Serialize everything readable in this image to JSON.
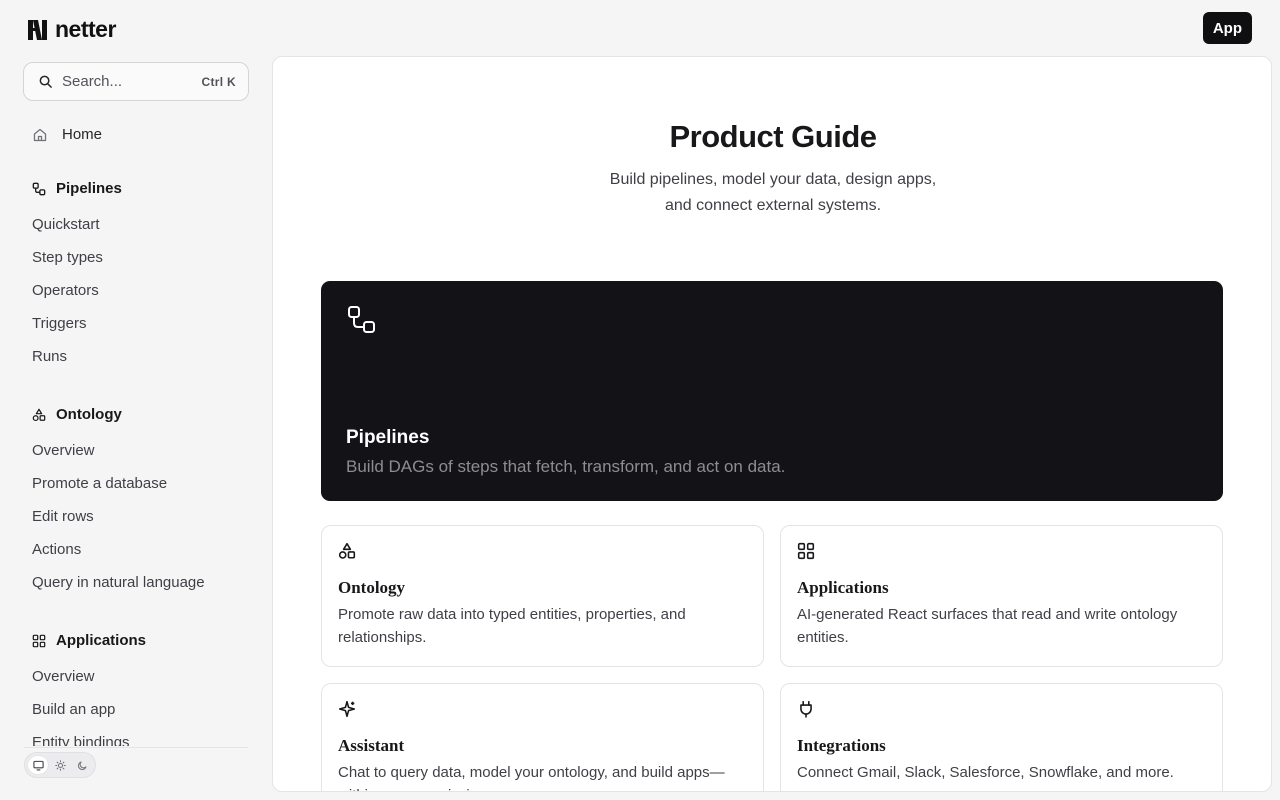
{
  "brand": {
    "name": "netter"
  },
  "header": {
    "app_button": "App"
  },
  "search": {
    "placeholder": "Search...",
    "shortcut": "Ctrl K"
  },
  "sidebar": {
    "home": "Home",
    "sections": [
      {
        "title": "Pipelines",
        "icon": "pipeline-icon",
        "items": [
          "Quickstart",
          "Step types",
          "Operators",
          "Triggers",
          "Runs"
        ]
      },
      {
        "title": "Ontology",
        "icon": "shapes-icon",
        "items": [
          "Overview",
          "Promote a database",
          "Edit rows",
          "Actions",
          "Query in natural language"
        ]
      },
      {
        "title": "Applications",
        "icon": "layout-grid-icon",
        "items": [
          "Overview",
          "Build an app",
          "Entity bindings"
        ]
      }
    ]
  },
  "theme": {
    "options": [
      "monitor-icon",
      "sun-icon",
      "moon-icon"
    ],
    "active": "system"
  },
  "main": {
    "title": "Product Guide",
    "subtitle": "Build pipelines, model your data, design apps, and connect external systems.",
    "hero": {
      "title": "Pipelines",
      "description": "Build DAGs of steps that fetch, transform, and act on data."
    },
    "cards": [
      {
        "title": "Ontology",
        "description": "Promote raw data into typed entities, properties, and relationships.",
        "icon": "shapes-icon"
      },
      {
        "title": "Applications",
        "description": "AI-generated React surfaces that read and write ontology entities.",
        "icon": "layout-grid-icon"
      },
      {
        "title": "Assistant",
        "description": "Chat to query data, model your ontology, and build apps—within your permissions.",
        "icon": "sparkles-icon"
      },
      {
        "title": "Integrations",
        "description": "Connect Gmail, Slack, Salesforce, Snowflake, and more.",
        "icon": "plug-icon"
      }
    ]
  },
  "colors": {
    "hero_bg": "#131217",
    "app_button_bg": "#0f0f12",
    "page_bg": "#f5f5f5"
  }
}
